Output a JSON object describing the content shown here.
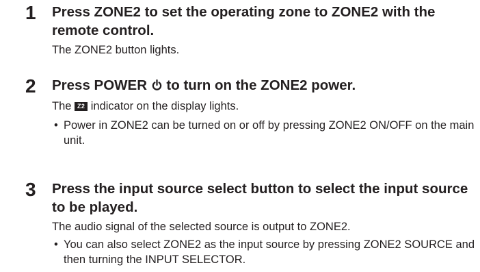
{
  "steps": [
    {
      "number": "1",
      "title": "Press ZONE2 to set the operating zone to ZONE2 with the remote control.",
      "text": "The ZONE2 button lights.",
      "bullets": []
    },
    {
      "number": "2",
      "title_before_icon": "Press POWER ",
      "title_icon": "power-icon",
      "title_after_icon": " to turn on the ZONE2 power.",
      "text_before_badge": "The ",
      "badge": "Z2",
      "text_after_badge": " indicator on the display lights.",
      "bullets": [
        "Power in ZONE2 can be turned on or off by pressing ZONE2 ON/OFF on the main unit."
      ]
    },
    {
      "number": "3",
      "title": "Press the input source select button to select the input source to be played.",
      "text": "The audio signal of the selected source is output to ZONE2.",
      "bullets": [
        "You can also select ZONE2 as the input source by pressing ZONE2 SOURCE and then turning the INPUT SELECTOR."
      ]
    }
  ],
  "bullet_symbol": "•"
}
